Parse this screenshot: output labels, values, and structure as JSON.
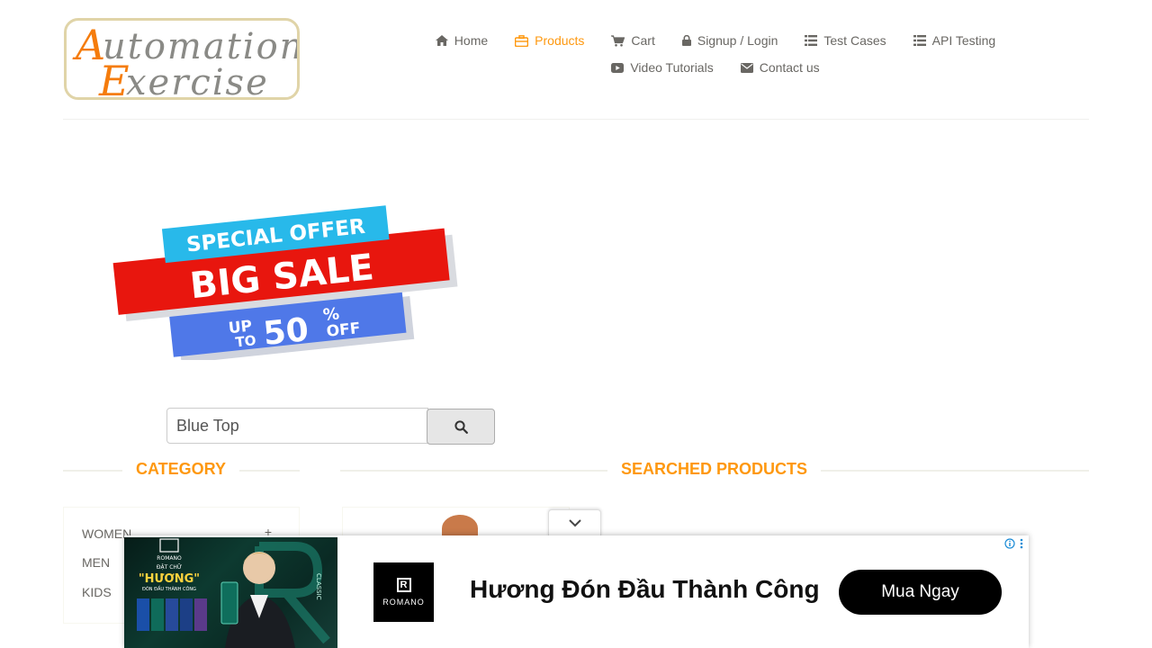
{
  "logo": {
    "first_a": "A",
    "rest_a": "utomation",
    "first_e": "E",
    "rest_e": "xercise"
  },
  "nav": {
    "row1": [
      {
        "label": "Home",
        "icon": "home-icon"
      },
      {
        "label": "Products",
        "icon": "briefcase-icon",
        "active": true
      },
      {
        "label": "Cart",
        "icon": "cart-icon"
      },
      {
        "label": "Signup / Login",
        "icon": "lock-icon"
      },
      {
        "label": "Test Cases",
        "icon": "list-icon"
      },
      {
        "label": "API Testing",
        "icon": "list-icon"
      }
    ],
    "row2": [
      {
        "label": "Video Tutorials",
        "icon": "youtube-play-icon"
      },
      {
        "label": "Contact us",
        "icon": "envelope-icon"
      }
    ]
  },
  "banner": {
    "line1": "SPECIAL OFFER",
    "line2": "BIG SALE",
    "up": "UP",
    "to": "TO",
    "pct": "50",
    "pct_sign": "%",
    "off": "OFF"
  },
  "search": {
    "value": "Blue Top",
    "button_icon": "search-icon"
  },
  "sections": {
    "category": "Category",
    "searched": "Searched Products"
  },
  "categories": [
    {
      "label": "Women",
      "expand": "+"
    },
    {
      "label": "Men",
      "expand": "+"
    },
    {
      "label": "Kids",
      "expand": "+"
    }
  ],
  "ad": {
    "image_brand": "ROMANO",
    "image_tag": "ĐẬT CHỮ",
    "image_title": "\"HƯƠNG\"",
    "image_sub": "ĐÓN ĐẦU THÀNH CÔNG",
    "image_side": "CLASSIC",
    "brand": "ROMANO",
    "headline": "Hương Đón Đầu Thành Công",
    "cta": "Mua Ngay",
    "toggle_icon": "chevron-down-icon",
    "info_icon": "info-icon",
    "menu_icon": "more-vertical-icon"
  },
  "colors": {
    "accent": "#fe980f",
    "text": "#696763",
    "ad_cta_bg": "#000000"
  }
}
